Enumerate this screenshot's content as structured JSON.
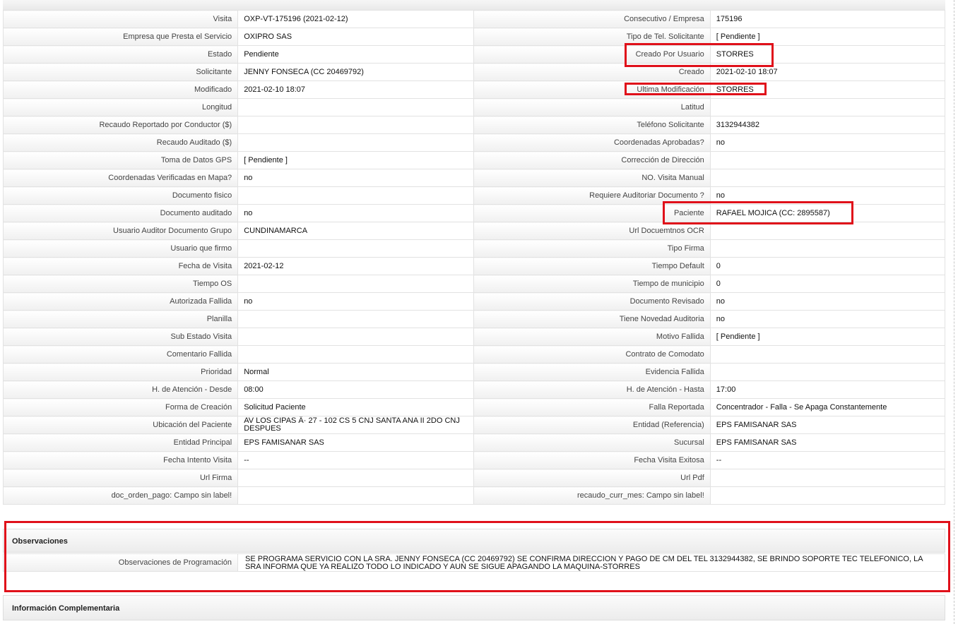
{
  "rows": [
    {
      "l1": "Visita",
      "v1": "OXP-VT-175196 (2021-02-12)",
      "l2": "Consecutivo / Empresa",
      "v2": "175196"
    },
    {
      "l1": "Empresa que Presta el Servicio",
      "v1": "OXIPRO SAS",
      "l2": "Tipo de Tel. Solicitante",
      "v2": "[ Pendiente ]"
    },
    {
      "l1": "Estado",
      "v1": "Pendiente",
      "l2": "Creado Por Usuario",
      "v2": "STORRES"
    },
    {
      "l1": "Solicitante",
      "v1": "JENNY FONSECA (CC 20469792)",
      "l2": "Creado",
      "v2": "2021-02-10 18:07"
    },
    {
      "l1": "Modificado",
      "v1": "2021-02-10 18:07",
      "l2": "Ultima Modificación",
      "v2": "STORRES"
    },
    {
      "l1": "Longitud",
      "v1": "",
      "l2": "Latitud",
      "v2": ""
    },
    {
      "l1": "Recaudo Reportado por Conductor ($)",
      "v1": "",
      "l2": "Teléfono Solicitante",
      "v2": "3132944382"
    },
    {
      "l1": "Recaudo Auditado ($)",
      "v1": "",
      "l2": "Coordenadas Aprobadas?",
      "v2": "no"
    },
    {
      "l1": "Toma de Datos GPS",
      "v1": "[ Pendiente ]",
      "l2": "Corrección de Dirección",
      "v2": ""
    },
    {
      "l1": "Coordenadas Verificadas en Mapa?",
      "v1": "no",
      "l2": "NO. Visita Manual",
      "v2": ""
    },
    {
      "l1": "Documento fisico",
      "v1": "",
      "l2": "Requiere Auditoriar Documento ?",
      "v2": "no"
    },
    {
      "l1": "Documento auditado",
      "v1": "no",
      "l2": "Paciente",
      "v2": "RAFAEL MOJICA (CC: 2895587)"
    },
    {
      "l1": "Usuario Auditor Documento Grupo",
      "v1": "CUNDINAMARCA",
      "l2": "Url Docuemtnos OCR",
      "v2": ""
    },
    {
      "l1": "Usuario que firmo",
      "v1": "",
      "l2": "Tipo Firma",
      "v2": ""
    },
    {
      "l1": "Fecha de Visita",
      "v1": "2021-02-12",
      "l2": "Tiempo Default",
      "v2": "0"
    },
    {
      "l1": "Tiempo OS",
      "v1": "",
      "l2": "Tiempo de municipio",
      "v2": "0"
    },
    {
      "l1": "Autorizada Fallida",
      "v1": "no",
      "l2": "Documento Revisado",
      "v2": "no"
    },
    {
      "l1": "Planilla",
      "v1": "",
      "l2": "Tiene Novedad Auditoria",
      "v2": "no"
    },
    {
      "l1": "Sub Estado Visita",
      "v1": "",
      "l2": "Motivo Fallida",
      "v2": "[ Pendiente ]"
    },
    {
      "l1": "Comentario Fallida",
      "v1": "",
      "l2": "Contrato de Comodato",
      "v2": ""
    },
    {
      "l1": "Prioridad",
      "v1": "Normal",
      "l2": "Evidencia Fallida",
      "v2": ""
    },
    {
      "l1": "H. de Atención - Desde",
      "v1": "08:00",
      "l2": "H. de Atención - Hasta",
      "v2": "17:00"
    },
    {
      "l1": "Forma de Creación",
      "v1": "Solicitud Paciente",
      "l2": "Falla Reportada",
      "v2": "Concentrador - Falla - Se Apaga Constantemente"
    },
    {
      "l1": "Ubicación del Paciente",
      "v1": "AV LOS CIPAS Â· 27 - 102 CS 5 CNJ SANTA ANA II 2DO CNJ DESPUES",
      "l2": "Entidad (Referencia)",
      "v2": "EPS FAMISANAR SAS"
    },
    {
      "l1": "Entidad Principal",
      "v1": "EPS FAMISANAR SAS",
      "l2": "Sucursal",
      "v2": "EPS FAMISANAR SAS"
    },
    {
      "l1": "Fecha Intento Visita",
      "v1": "--",
      "l2": "Fecha Visita Exitosa",
      "v2": "--"
    },
    {
      "l1": "Url Firma",
      "v1": "",
      "l2": "Url Pdf",
      "v2": ""
    },
    {
      "l1": "doc_orden_pago: Campo sin label!",
      "v1": "",
      "l2": "recaudo_curr_mes: Campo sin label!",
      "v2": ""
    }
  ],
  "observaciones": {
    "title": "Observaciones",
    "label": "Observaciones de Programación",
    "value": "SE PROGRAMA SERVICIO CON LA SRA. JENNY FONSECA (CC 20469792) SE CONFIRMA DIRECCION Y PAGO DE CM DEL TEL 3132944382, SE BRINDO SOPORTE TEC TELEFONICO, LA SRA INFORMA QUE YA REALIZO TODO LO INDICADO Y AUN SE SIGUE APAGANDO LA MAQUINA-STORRES"
  },
  "complementaria": {
    "title": "Información Complementaria"
  },
  "highlight_color": "#e0101a"
}
